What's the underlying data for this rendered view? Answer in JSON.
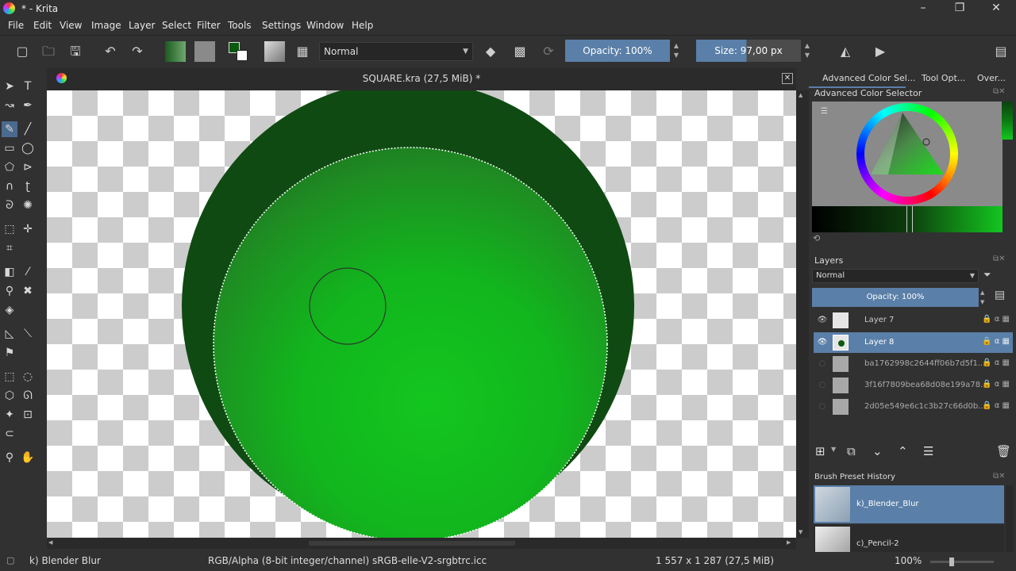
{
  "window": {
    "title": "* - Krita",
    "minimize": "–",
    "maximize": "❐",
    "close": "✕"
  },
  "menu": [
    "File",
    "Edit",
    "View",
    "Image",
    "Layer",
    "Select",
    "Filter",
    "Tools",
    "Settings",
    "Window",
    "Help"
  ],
  "toolbar": {
    "blend_mode": "Normal",
    "opacity_label": "Opacity: 100%",
    "size_label": "Size: 97,00 px"
  },
  "document": {
    "tab_title": "SQUARE.kra (27,5 MiB) *",
    "close_icon": "close-icon"
  },
  "dock": {
    "tabs": [
      "Advanced Color Sel...",
      "Tool Opt...",
      "Over..."
    ],
    "color_selector_title": "Advanced Color Selector",
    "layers_title": "Layers",
    "layers_blend": "Normal",
    "layers_opacity": "Opacity:  100%",
    "layers": [
      {
        "name": "Layer 7",
        "selected": false,
        "visible": true
      },
      {
        "name": "Layer 8",
        "selected": true,
        "visible": true
      },
      {
        "name": "ba1762998c2644ff06b7d5f1...",
        "selected": false,
        "visible": false
      },
      {
        "name": "3f16f7809bea68d08e199a78...",
        "selected": false,
        "visible": false
      },
      {
        "name": "2d05e549e6c1c3b27c66d0b...",
        "selected": false,
        "visible": false
      }
    ],
    "brush_history_title": "Brush Preset History",
    "brush_history": [
      "k)_Blender_Blur",
      "c)_Pencil-2"
    ]
  },
  "status": {
    "brush": "k) Blender Blur",
    "color_space": "RGB/Alpha (8-bit integer/channel)  sRGB-elle-V2-srgbtrc.icc",
    "dimensions": "1 557 x 1 287 (27,5 MiB)",
    "zoom": "100%"
  },
  "colors": {
    "accent": "#5a7fa8",
    "dark_green": "#0f4a12",
    "bright_green": "#13c61f"
  }
}
